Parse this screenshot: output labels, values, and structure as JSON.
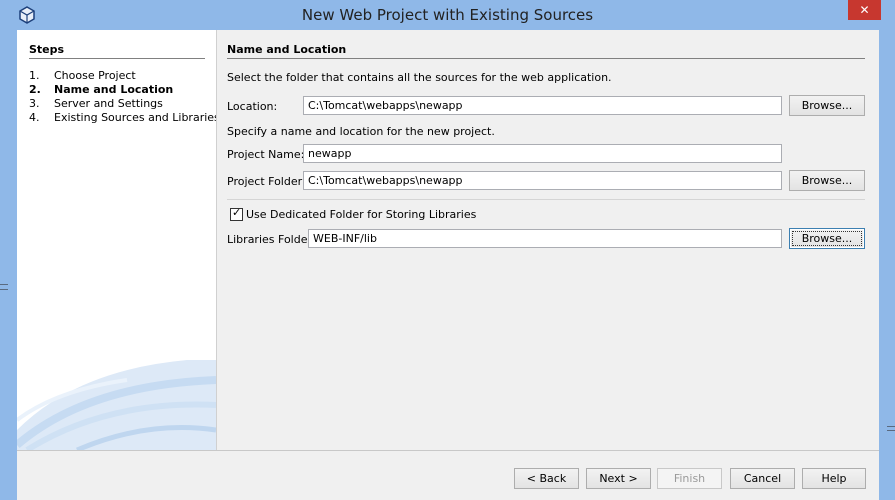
{
  "window": {
    "title": "New Web Project with Existing Sources",
    "close_label": "✕"
  },
  "steps": {
    "title": "Steps",
    "items": [
      {
        "num": "1.",
        "label": "Choose Project"
      },
      {
        "num": "2.",
        "label": "Name and Location"
      },
      {
        "num": "3.",
        "label": "Server and Settings"
      },
      {
        "num": "4.",
        "label": "Existing Sources and Libraries"
      }
    ]
  },
  "panel": {
    "title": "Name and Location",
    "instruction": "Select the folder that contains all the sources for the web application.",
    "location_label": "Location:",
    "location_value": "C:\\Tomcat\\webapps\\newapp",
    "specify_text": "Specify a name and location for the new project.",
    "project_name_label": "Project Name:",
    "project_name_value": "newapp",
    "project_folder_label": "Project Folder:",
    "project_folder_value": "C:\\Tomcat\\webapps\\newapp",
    "dedicated_folder_label": "Use Dedicated Folder for Storing Libraries",
    "libraries_folder_label": "Libraries Folder:",
    "libraries_folder_value": "WEB-INF/lib",
    "browse_label": "Browse..."
  },
  "footer": {
    "back": "< Back",
    "next": "Next >",
    "finish": "Finish",
    "cancel": "Cancel",
    "help": "Help"
  },
  "colors": {
    "titlebar": "#8fb8e8",
    "close": "#c7372f"
  }
}
